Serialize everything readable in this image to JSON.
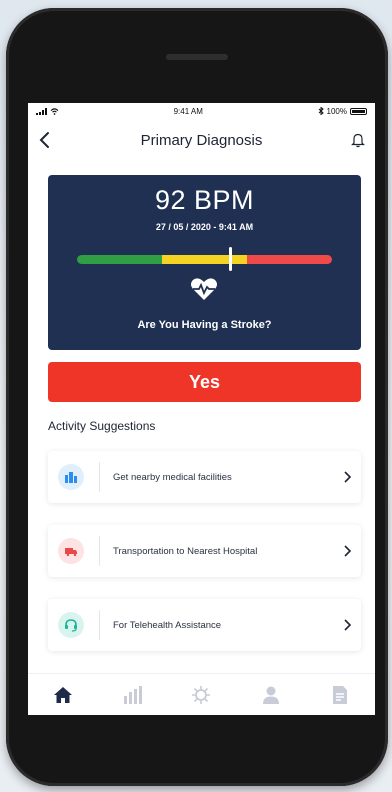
{
  "status_bar": {
    "time": "9:41 AM",
    "battery": "100%"
  },
  "header": {
    "title": "Primary Diagnosis",
    "back_icon": "chevron-left-icon",
    "bell_icon": "bell-icon"
  },
  "reading": {
    "bpm": "92 BPM",
    "datetime": "27 / 05 / 2020 - 9:41 AM",
    "question": "Are You Having a Stroke?",
    "gauge_level": 0.6,
    "gauge_colors": {
      "green": "#2f9e44",
      "yellow": "#f5d322",
      "red": "#ef4a4a"
    }
  },
  "yes_button": {
    "label": "Yes",
    "color": "#ef3527"
  },
  "activity": {
    "title": "Activity Suggestions",
    "items": [
      {
        "label": "Get nearby medical facilities",
        "icon": "buildings-icon",
        "color": "#2d8cf0"
      },
      {
        "label": "Transportation to Nearest Hospital",
        "icon": "ambulance-icon",
        "color": "#e84a4a"
      },
      {
        "label": "For Telehealth Assistance",
        "icon": "headset-icon",
        "color": "#18b69b"
      }
    ]
  },
  "tabs": [
    {
      "icon": "home-icon",
      "active": true
    },
    {
      "icon": "bar-chart-icon",
      "active": false
    },
    {
      "icon": "virus-icon",
      "active": false
    },
    {
      "icon": "profile-icon",
      "active": false
    },
    {
      "icon": "document-icon",
      "active": false
    }
  ]
}
